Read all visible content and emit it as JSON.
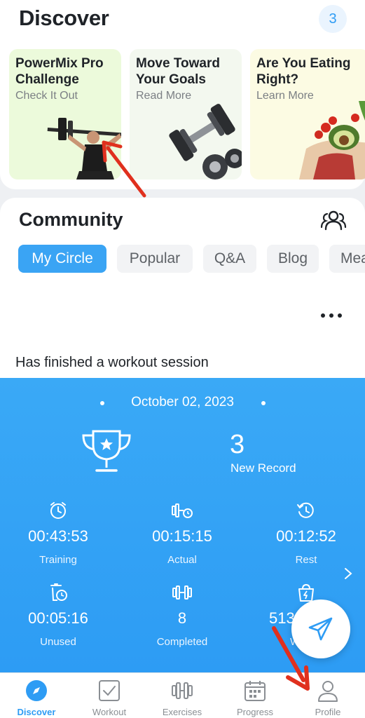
{
  "discover": {
    "title": "Discover",
    "badge_count": "3",
    "cards": [
      {
        "title": "PowerMix Pro Challenge",
        "link": "Check It Out",
        "art": "weightlifter-image"
      },
      {
        "title": "Move Toward Your Goals",
        "link": "Read More",
        "art": "dumbbell-image"
      },
      {
        "title": "Are You Eating Right?",
        "link": "Learn More",
        "art": "food-image"
      }
    ]
  },
  "community": {
    "title": "Community",
    "tabs": [
      "My Circle",
      "Popular",
      "Q&A",
      "Blog",
      "Mea"
    ],
    "active_tab": "My Circle",
    "post_text": "Has finished a workout session"
  },
  "workout": {
    "date": "October 02, 2023",
    "record_value": "3",
    "record_label": "New Record",
    "stats": [
      {
        "value": "00:43:53",
        "label": "Training",
        "icon": "stopwatch-icon"
      },
      {
        "value": "00:15:15",
        "label": "Actual",
        "icon": "dumbbell-clock-icon"
      },
      {
        "value": "00:12:52",
        "label": "Rest",
        "icon": "rest-clock-icon"
      },
      {
        "value": "00:05:16",
        "label": "Unused",
        "icon": "trash-clock-icon"
      },
      {
        "value": "8",
        "label": "Completed",
        "icon": "dumbbell-icon"
      },
      {
        "value": "513",
        "label": "W",
        "icon": "bag-bolt-icon"
      }
    ]
  },
  "tabbar": {
    "items": [
      {
        "label": "Discover",
        "icon": "compass-icon",
        "active": true
      },
      {
        "label": "Workout",
        "icon": "checkbox-icon",
        "active": false
      },
      {
        "label": "Exercises",
        "icon": "dumbbell-icon",
        "active": false
      },
      {
        "label": "Progress",
        "icon": "calendar-icon",
        "active": false
      },
      {
        "label": "Profile",
        "icon": "person-icon",
        "active": false
      }
    ]
  },
  "colors": {
    "accent": "#2e9cf4",
    "workout_card": "#38a6f5",
    "annotation_arrow": "#e0301e"
  }
}
